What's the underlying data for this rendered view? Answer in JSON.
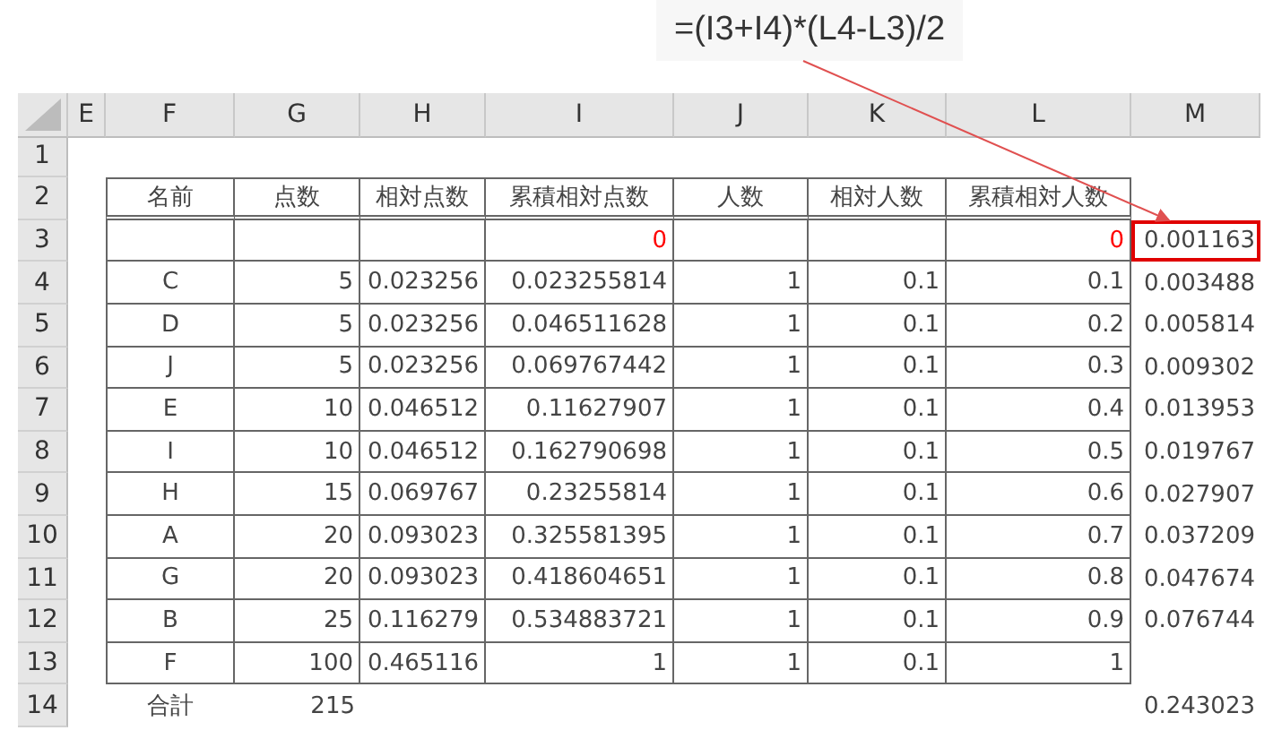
{
  "formula_callout": {
    "text": "=(I3+I4)*(L4-L3)/2"
  },
  "columns": [
    {
      "label": "E"
    },
    {
      "label": "F"
    },
    {
      "label": "G"
    },
    {
      "label": "H"
    },
    {
      "label": "I"
    },
    {
      "label": "J"
    },
    {
      "label": "K"
    },
    {
      "label": "L"
    },
    {
      "label": "M"
    }
  ],
  "rows": [
    {
      "number": "1",
      "cells": {}
    },
    {
      "number": "2",
      "cells": {
        "F": "名前",
        "G": "点数",
        "H": "相対点数",
        "I": "累積相対点数",
        "J": "人数",
        "K": "相対人数",
        "L": "累積相対人数"
      }
    },
    {
      "number": "3",
      "cells": {
        "I": {
          "text": "0",
          "color": "#ff0000"
        },
        "L": {
          "text": "0",
          "color": "#ff0000"
        },
        "M": {
          "text": "0.001163",
          "highlighted": true
        }
      }
    },
    {
      "number": "4",
      "cells": {
        "F": "C",
        "G": "5",
        "H": "0.023256",
        "I": "0.023255814",
        "J": "1",
        "K": "0.1",
        "L": "0.1",
        "M": "0.003488"
      }
    },
    {
      "number": "5",
      "cells": {
        "F": "D",
        "G": "5",
        "H": "0.023256",
        "I": "0.046511628",
        "J": "1",
        "K": "0.1",
        "L": "0.2",
        "M": "0.005814"
      }
    },
    {
      "number": "6",
      "cells": {
        "F": "J",
        "G": "5",
        "H": "0.023256",
        "I": "0.069767442",
        "J": "1",
        "K": "0.1",
        "L": "0.3",
        "M": "0.009302"
      }
    },
    {
      "number": "7",
      "cells": {
        "F": "E",
        "G": "10",
        "H": "0.046512",
        "I": "0.11627907",
        "J": "1",
        "K": "0.1",
        "L": "0.4",
        "M": "0.013953"
      }
    },
    {
      "number": "8",
      "cells": {
        "F": "I",
        "G": "10",
        "H": "0.046512",
        "I": "0.162790698",
        "J": "1",
        "K": "0.1",
        "L": "0.5",
        "M": "0.019767"
      }
    },
    {
      "number": "9",
      "cells": {
        "F": "H",
        "G": "15",
        "H": "0.069767",
        "I": "0.23255814",
        "J": "1",
        "K": "0.1",
        "L": "0.6",
        "M": "0.027907"
      }
    },
    {
      "number": "10",
      "cells": {
        "F": "A",
        "G": "20",
        "H": "0.093023",
        "I": "0.325581395",
        "J": "1",
        "K": "0.1",
        "L": "0.7",
        "M": "0.037209"
      }
    },
    {
      "number": "11",
      "cells": {
        "F": "G",
        "G": "20",
        "H": "0.093023",
        "I": "0.418604651",
        "J": "1",
        "K": "0.1",
        "L": "0.8",
        "M": "0.047674"
      }
    },
    {
      "number": "12",
      "cells": {
        "F": "B",
        "G": "25",
        "H": "0.116279",
        "I": "0.534883721",
        "J": "1",
        "K": "0.1",
        "L": "0.9",
        "M": "0.076744"
      }
    },
    {
      "number": "13",
      "cells": {
        "F": "F",
        "G": "100",
        "H": "0.465116",
        "I": "1",
        "J": "1",
        "K": "0.1",
        "L": "1"
      }
    },
    {
      "number": "14",
      "cells": {
        "F": "合計",
        "G": "215",
        "M": "0.243023"
      }
    }
  ]
}
